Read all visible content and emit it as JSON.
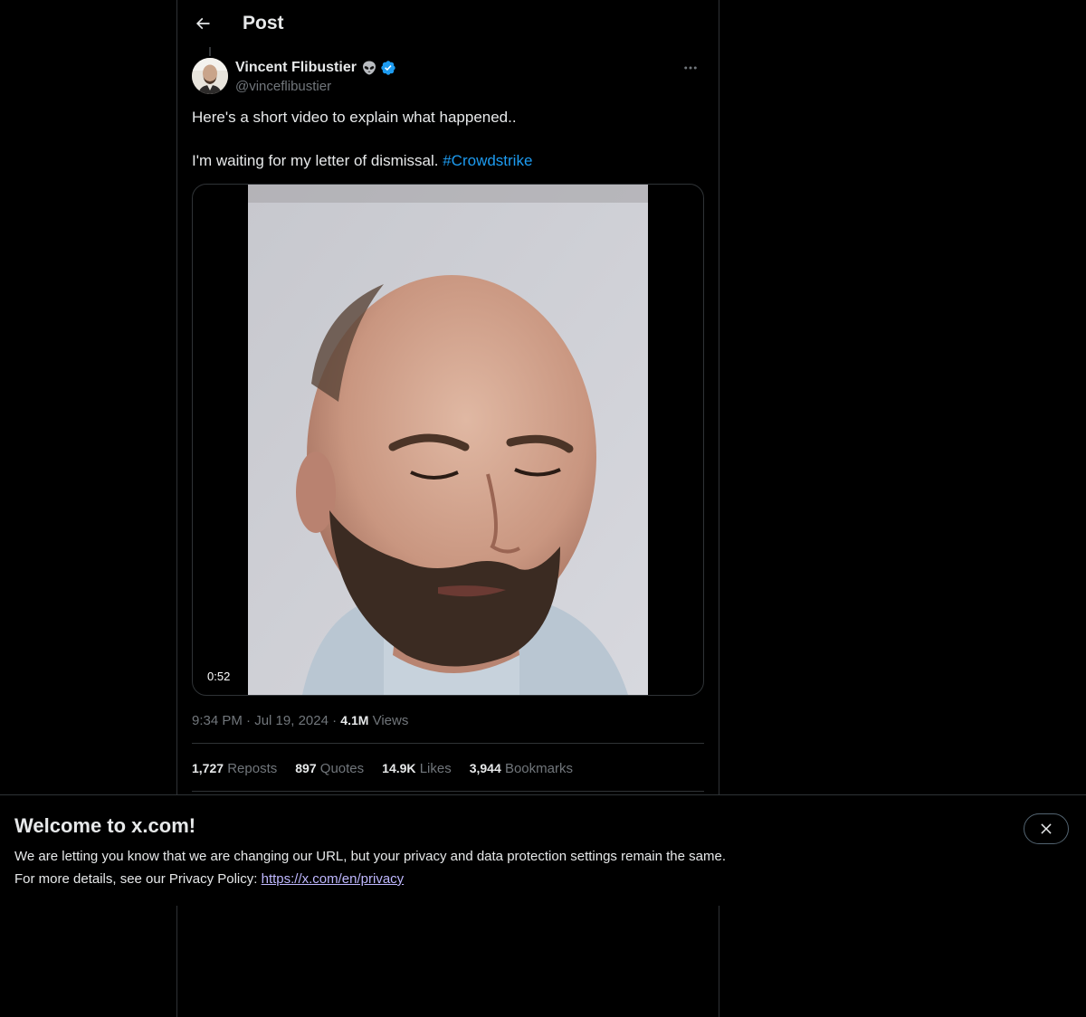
{
  "header": {
    "title": "Post",
    "back_icon": "arrow-left-icon"
  },
  "post": {
    "author": {
      "display_name": "Vincent Flibustier",
      "handle": "@vinceflibustier",
      "badge_emoji": "alien-icon",
      "verified": true,
      "verified_color": "#1d9bf0"
    },
    "text_line_1": "Here's a short video to explain what happened..",
    "text_line_2": "I'm waiting for my letter of dismissal.",
    "hashtag": "#Crowdstrike",
    "video": {
      "duration": "0:52"
    },
    "time": "9:34 PM",
    "date": "Jul 19, 2024",
    "separator": "·",
    "views_count": "4.1M",
    "views_label": "Views",
    "stats": [
      {
        "count": "1,727",
        "label": "Reposts"
      },
      {
        "count": "897",
        "label": "Quotes"
      },
      {
        "count": "14.9K",
        "label": "Likes"
      },
      {
        "count": "3,944",
        "label": "Bookmarks"
      }
    ]
  },
  "banner": {
    "title": "Welcome to x.com!",
    "line_1": "We are letting you know that we are changing our URL, but your privacy and data protection settings remain the same.",
    "line_2_prefix": "For more details, see our Privacy Policy:",
    "link": "https://x.com/en/privacy",
    "close_icon": "close-icon"
  },
  "colors": {
    "background": "#000000",
    "text_primary": "#e7e9ea",
    "text_secondary": "#71767b",
    "accent": "#1d9bf0",
    "border": "#2f3336",
    "link_visited": "#bfb8ff"
  }
}
